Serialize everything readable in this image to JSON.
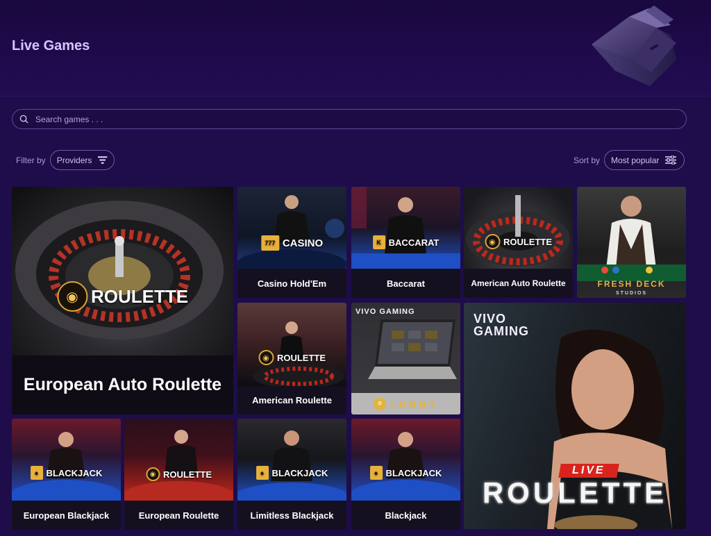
{
  "page": {
    "title": "Live Games"
  },
  "search": {
    "placeholder": "Search games . . .",
    "icon": "search-icon"
  },
  "filter": {
    "label": "Filter by",
    "button": "Providers",
    "icon": "filter-funnel-icon"
  },
  "sort": {
    "label": "Sort by",
    "selected": "Most popular",
    "icon": "sliders-icon"
  },
  "colors": {
    "background": "#1e0d4a",
    "title": "#d6c6ff",
    "badge_gold": "#e9b13a",
    "table_blue": "#1f4fc4",
    "roulette_red": "#c0271b"
  },
  "games": [
    {
      "title": "European Auto Roulette",
      "badge": "ROULETTE",
      "badge_icon": "roulette-chip-icon"
    },
    {
      "title": "Casino Hold'Em",
      "badge": "CASINO",
      "badge_icon": "slot-777-icon"
    },
    {
      "title": "Baccarat",
      "badge": "BACCARAT",
      "badge_icon": "card-k-icon"
    },
    {
      "title": "American Auto Roulette",
      "badge": "ROULETTE",
      "badge_icon": "roulette-chip-icon"
    },
    {
      "title": "",
      "badge": "FRESH DECK",
      "sub": "STUDIOS",
      "badge_icon": "fresh-deck-logo"
    },
    {
      "title": "American Roulette",
      "badge": "ROULETTE",
      "badge_icon": "roulette-chip-icon"
    },
    {
      "title": "",
      "badge": "LOBBY",
      "logo": "VIVO GAMING",
      "badge_icon": "lobby-icon"
    },
    {
      "title": "",
      "badge": "ROULETTE",
      "tag": "LIVE",
      "logo": "VIVO GAMING",
      "badge_icon": "vivo-dice-icon"
    },
    {
      "title": "European Blackjack",
      "badge": "BLACKJACK",
      "badge_icon": "card-spade-icon"
    },
    {
      "title": "European Roulette",
      "badge": "ROULETTE",
      "badge_icon": "roulette-chip-icon"
    },
    {
      "title": "Limitless Blackjack",
      "badge": "BLACKJACK",
      "badge_icon": "card-spade-icon"
    },
    {
      "title": "Blackjack",
      "badge": "BLACKJACK",
      "badge_icon": "card-spade-icon"
    }
  ]
}
